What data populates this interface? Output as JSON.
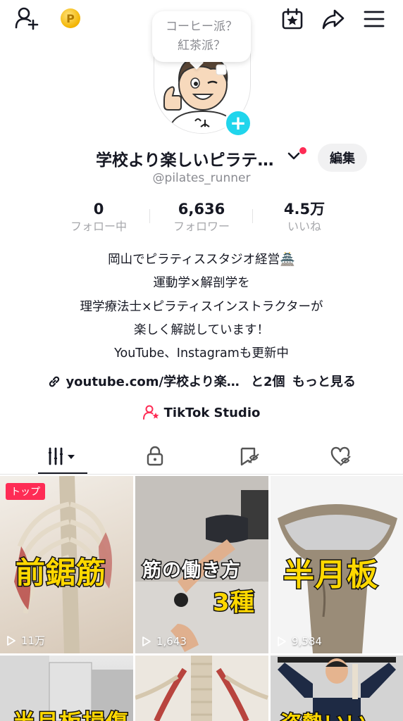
{
  "topbar": {
    "icons": [
      "add-friend-icon",
      "coin-icon",
      "calendar-star-icon",
      "share-icon",
      "menu-icon"
    ],
    "coin_symbol": "P"
  },
  "bubble": {
    "line1": "コーヒー派？",
    "line2": "紅茶派？"
  },
  "profile": {
    "name": "学校より楽しいピラテ…",
    "username": "@pilates_runner",
    "edit_label": "編集",
    "add_photo_symbol": "+"
  },
  "stats": [
    {
      "value": "0",
      "label": "フォロー中"
    },
    {
      "value": "6,636",
      "label": "フォロワー"
    },
    {
      "value": "4.5万",
      "label": "いいね"
    }
  ],
  "bio": [
    "岡山でピラティススタジオ経営🏯",
    "運動学×解剖学を",
    "理学療法士×ピラティスインストラクターが",
    "楽しく解説しています！",
    "YouTube、Instagramも更新中"
  ],
  "link": {
    "url": "youtube.com/学校より楽…",
    "more": "と2個",
    "see_more": "もっと見る"
  },
  "studio": {
    "label": "TikTok Studio"
  },
  "tabs": [
    "videos-tab",
    "private-tab",
    "reposts-tab",
    "liked-tab"
  ],
  "videos": [
    {
      "title": "前鋸筋",
      "views": "11万",
      "badge": "トップ"
    },
    {
      "title_line1": "筋の働き方",
      "title_line2": "3種",
      "views": "1,643"
    },
    {
      "title": "半月板",
      "views": "9,584"
    },
    {
      "title": "半月板損傷",
      "views": ""
    },
    {
      "title": "",
      "views": ""
    },
    {
      "title": "姿勢いい",
      "views": ""
    }
  ],
  "colors": {
    "accent": "#fe2c55",
    "cyan": "#20d5ec",
    "badge_yellow": "#ffd800"
  }
}
